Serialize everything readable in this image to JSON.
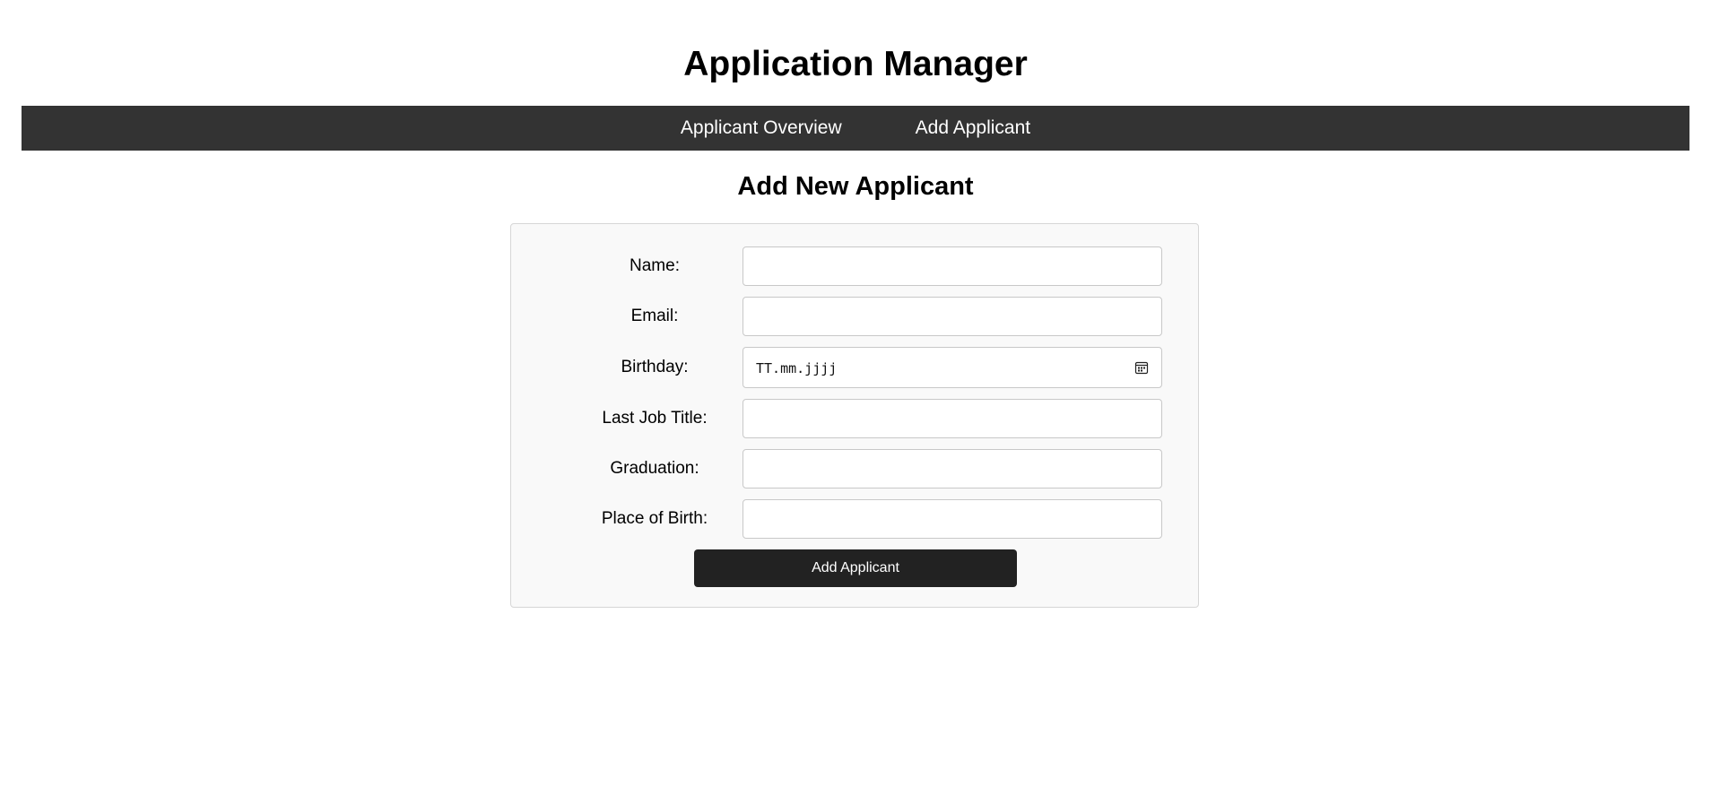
{
  "app": {
    "title": "Application Manager"
  },
  "nav": {
    "items": [
      {
        "label": "Applicant Overview"
      },
      {
        "label": "Add Applicant"
      }
    ]
  },
  "page": {
    "title": "Add New Applicant"
  },
  "form": {
    "fields": [
      {
        "label": "Name:",
        "value": "",
        "placeholder": ""
      },
      {
        "label": "Email:",
        "value": "",
        "placeholder": ""
      },
      {
        "label": "Birthday:",
        "value": "",
        "placeholder": "TT.mm.jjjj",
        "icon": "calendar-icon"
      },
      {
        "label": "Last Job Title:",
        "value": "",
        "placeholder": ""
      },
      {
        "label": "Graduation:",
        "value": "",
        "placeholder": ""
      },
      {
        "label": "Place of Birth:",
        "value": "",
        "placeholder": ""
      }
    ],
    "submit_label": "Add Applicant"
  },
  "colors": {
    "navbar_bg": "#333333",
    "button_bg": "#222222",
    "panel_bg": "#f9f9f9",
    "panel_border": "#d6d6d6"
  }
}
